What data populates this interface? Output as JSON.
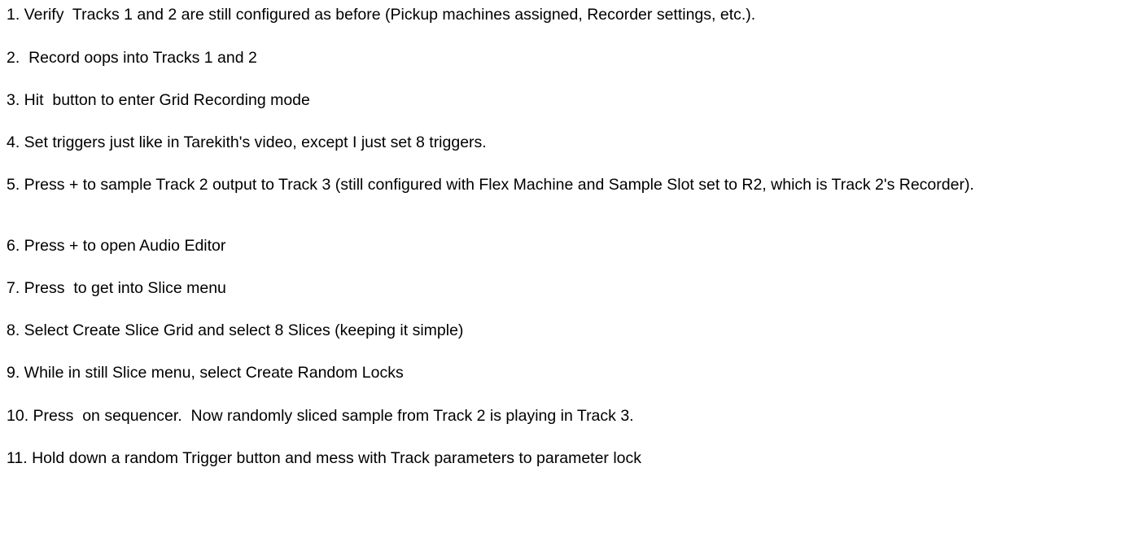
{
  "steps": [
    "1. Verify  Tracks 1 and 2 are still configured as before (Pickup machines assigned, Recorder settings, etc.).",
    "2.  Record oops into Tracks 1 and 2",
    "3. Hit  button to enter Grid Recording mode",
    "4. Set triggers just like in Tarekith's video, except I just set 8 triggers.",
    "5. Press + to sample Track 2 output to Track 3 (still configured with Flex Machine and Sample Slot set to R2, which is Track 2's Recorder).",
    "6. Press + to open Audio Editor",
    "7. Press  to get into Slice menu",
    "8. Select Create Slice Grid and select 8 Slices (keeping it simple)",
    "9. While in still Slice menu, select Create Random Locks",
    "10. Press  on sequencer.  Now randomly sliced sample from Track 2 is playing in Track 3.",
    "11. Hold down a random Trigger button and mess with Track parameters to parameter lock"
  ]
}
